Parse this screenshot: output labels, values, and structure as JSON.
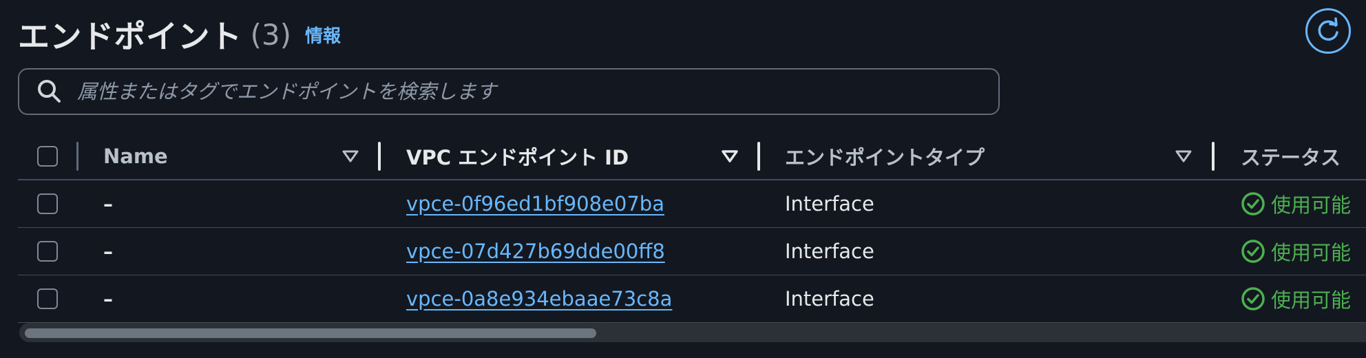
{
  "header": {
    "title": "エンドポイント",
    "count": "(3)",
    "info": "情報"
  },
  "search": {
    "placeholder": "属性またはタグでエンドポイントを検索します"
  },
  "table": {
    "columns": {
      "name": "Name",
      "id": "VPC エンドポイント ID",
      "type": "エンドポイントタイプ",
      "status": "ステータス"
    },
    "rows": [
      {
        "name": "–",
        "id": "vpce-0f96ed1bf908e07ba",
        "type": "Interface",
        "status": "使用可能"
      },
      {
        "name": "–",
        "id": "vpce-07d427b69dde00ff8",
        "type": "Interface",
        "status": "使用可能"
      },
      {
        "name": "–",
        "id": "vpce-0a8e934ebaae73c8a",
        "type": "Interface",
        "status": "使用可能"
      }
    ]
  },
  "icons": {
    "refresh": "refresh-icon",
    "search": "search-icon",
    "sort": "sort-desc-icon",
    "status_ok": "check-circle-icon"
  },
  "colors": {
    "background": "#131820",
    "link": "#69b7ff",
    "success": "#4cb050",
    "border": "#414d5c"
  }
}
